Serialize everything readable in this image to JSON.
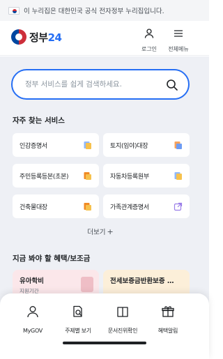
{
  "notice": {
    "text": "이 누리집은 대한민국 공식 전자정부 누리집입니다."
  },
  "header": {
    "logo_text": "정부",
    "logo_num": "24",
    "login_label": "로그인",
    "menu_label": "전체메뉴"
  },
  "search": {
    "placeholder": "정부 서비스를 쉽게 검색하세요."
  },
  "frequent": {
    "title": "자주 찾는 서비스",
    "items": [
      {
        "label": "인감증명서",
        "icon": "document-blue-icon"
      },
      {
        "label": "토지(임야)대장",
        "icon": "document-orange-icon"
      },
      {
        "label": "주민등록등본(초본)",
        "icon": "document-orange-icon"
      },
      {
        "label": "자동차등록원부",
        "icon": "document-blue-icon"
      },
      {
        "label": "건축물대장",
        "icon": "document-orange-icon"
      },
      {
        "label": "가족관계증명서",
        "icon": "external-link-icon"
      }
    ],
    "more_label": "더보기",
    "more_plus": "+"
  },
  "benefits": {
    "title": "지금 봐야 할 혜택/보조금",
    "items": [
      {
        "title": "유아학비",
        "sub": "지원기간"
      },
      {
        "title": "전세보증금반환보증 …",
        "sub": ""
      }
    ]
  },
  "bottom_nav": {
    "items": [
      {
        "label": "MyGOV",
        "icon": "person-icon"
      },
      {
        "label": "주제별 보기",
        "icon": "search-document-icon"
      },
      {
        "label": "문서진위확인",
        "icon": "book-icon"
      },
      {
        "label": "혜택알림",
        "icon": "gift-icon"
      }
    ]
  },
  "colors": {
    "primary": "#256ef4",
    "background": "#eef0f5",
    "orange": "#f08a24"
  }
}
